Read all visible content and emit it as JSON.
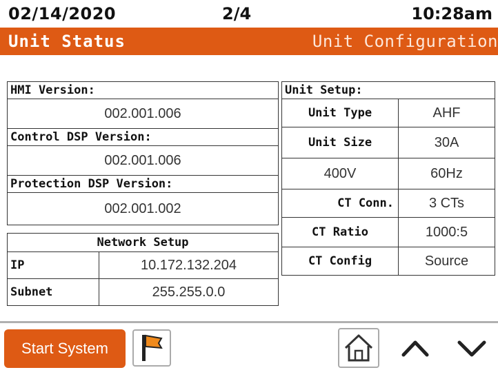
{
  "header": {
    "date": "02/14/2020",
    "page": "2/4",
    "time": "10:28am"
  },
  "tabs": {
    "active": "Unit Status",
    "inactive": "Unit Configuration"
  },
  "versions": {
    "hmi_label": "HMI Version:",
    "hmi_value": "002.001.006",
    "control_label": "Control DSP Version:",
    "control_value": "002.001.006",
    "protection_label": "Protection DSP Version:",
    "protection_value": "002.001.002"
  },
  "network": {
    "title": "Network Setup",
    "rows": [
      {
        "label": "IP",
        "value": "10.172.132.204"
      },
      {
        "label": "Subnet",
        "value": "255.255.0.0"
      }
    ]
  },
  "unit_setup": {
    "title": "Unit Setup:",
    "rows": [
      {
        "label": "Unit Type",
        "value": "AHF"
      },
      {
        "label": "Unit Size",
        "value": "30A"
      },
      {
        "label": "400V",
        "value": "60Hz"
      },
      {
        "label": "CT Conn.",
        "value": "3 CTs"
      },
      {
        "label": "CT Ratio",
        "value": "1000:5"
      },
      {
        "label": "CT Config",
        "value": "Source"
      }
    ]
  },
  "footer": {
    "start_label": "Start System",
    "icons": [
      "flag-icon",
      "home-icon",
      "chevron-up-icon",
      "chevron-down-icon"
    ],
    "accent": "#de5a14"
  }
}
